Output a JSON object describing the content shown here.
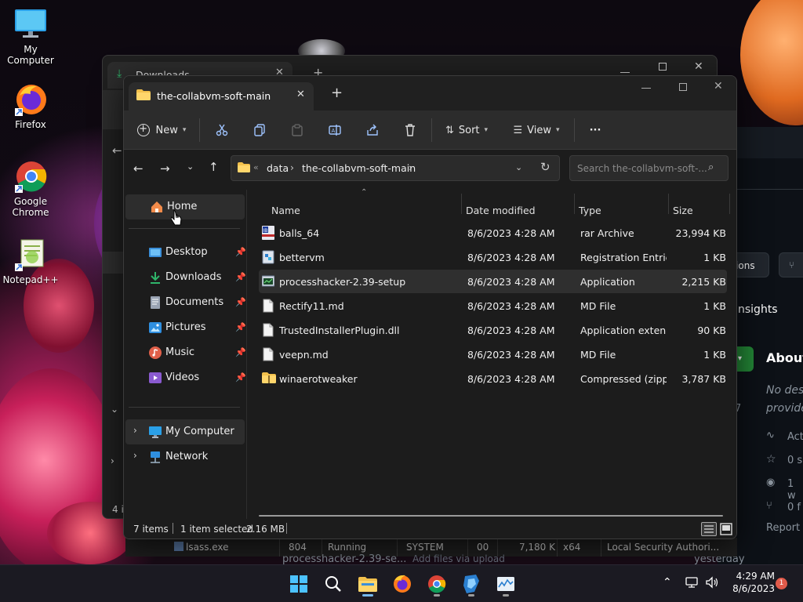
{
  "desktop": {
    "icons": [
      {
        "label": "My Computer"
      },
      {
        "label": "Firefox"
      },
      {
        "label": "Google Chrome"
      },
      {
        "label": "Notepad++"
      }
    ]
  },
  "back_window": {
    "tab_title": "Downloads",
    "status_fragment": "4 i"
  },
  "github_fragments": {
    "btn1": "ations",
    "insights": "nsights",
    "about": "About",
    "desc1": "No des",
    "desc2": "provide",
    "act": "Act",
    "s0": "0 s",
    "w1": "1 w",
    "f0": "0 f",
    "report": "Report",
    "seven": "7",
    "yesterday": "yesterday"
  },
  "taskmgr_row": {
    "name": "lsass.exe",
    "pid": "804",
    "status": "Running",
    "user": "SYSTEM",
    "cpu": "00",
    "mem": "7,180 K",
    "arch": "x64",
    "desc": "Local Security Authori...",
    "under_name": "processhacker-2.39-se...",
    "under_msg": "Add files via upload"
  },
  "explorer": {
    "tab_title": "the-collabvm-soft-main",
    "toolbar": {
      "new_label": "New",
      "sort_label": "Sort",
      "view_label": "View",
      "more_label": "···"
    },
    "breadcrumb": [
      "data",
      "the-collabvm-soft-main"
    ],
    "search_placeholder": "Search the-collabvm-soft-...",
    "nav": {
      "home": "Home",
      "quick": [
        {
          "label": "Desktop",
          "color": "#3b8fd9"
        },
        {
          "label": "Downloads",
          "color": "#2fb56a"
        },
        {
          "label": "Documents",
          "color": "#9aa4b4"
        },
        {
          "label": "Pictures",
          "color": "#2f8fe0"
        },
        {
          "label": "Music",
          "color": "#e0604a"
        },
        {
          "label": "Videos",
          "color": "#8a5ad0"
        }
      ],
      "my_computer": "My Computer",
      "network": "Network"
    },
    "columns": {
      "name": "Name",
      "date": "Date modified",
      "type": "Type",
      "size": "Size"
    },
    "files": [
      {
        "name": "balls_64",
        "date": "8/6/2023 4:28 AM",
        "type": "rar Archive",
        "size": "23,994 KB",
        "icon": "rar-icon"
      },
      {
        "name": "bettervm",
        "date": "8/6/2023 4:28 AM",
        "type": "Registration Entries",
        "size": "1 KB",
        "icon": "registry-icon"
      },
      {
        "name": "processhacker-2.39-setup",
        "date": "8/6/2023 4:28 AM",
        "type": "Application",
        "size": "2,215 KB",
        "icon": "application-icon",
        "selected": true
      },
      {
        "name": "Rectify11.md",
        "date": "8/6/2023 4:28 AM",
        "type": "MD File",
        "size": "1 KB",
        "icon": "document-icon"
      },
      {
        "name": "TrustedInstallerPlugin.dll",
        "date": "8/6/2023 4:28 AM",
        "type": "Application exten...",
        "size": "90 KB",
        "icon": "document-icon"
      },
      {
        "name": "veepn.md",
        "date": "8/6/2023 4:28 AM",
        "type": "MD File",
        "size": "1 KB",
        "icon": "document-icon"
      },
      {
        "name": "winaerotweaker",
        "date": "8/6/2023 4:28 AM",
        "type": "Compressed (zipp...",
        "size": "3,787 KB",
        "icon": "zip-folder-icon"
      }
    ],
    "status": {
      "items": "7 items",
      "selected": "1 item selected",
      "size": "2.16 MB"
    }
  },
  "taskbar": {
    "time": "4:29 AM",
    "date": "8/6/2023",
    "notification_count": "1"
  }
}
